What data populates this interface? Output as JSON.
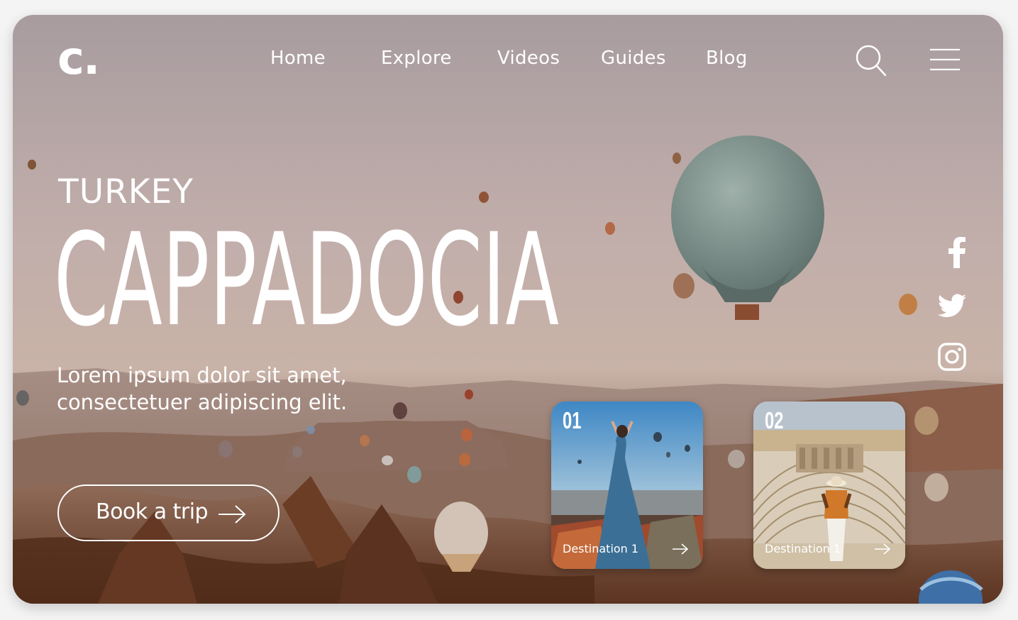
{
  "brand": {
    "logo": "c."
  },
  "nav": {
    "items": [
      "Home",
      "Explore",
      "Videos",
      "Guides",
      "Blog"
    ],
    "search_icon": "search-icon",
    "menu_icon": "hamburger-menu-icon"
  },
  "hero": {
    "eyebrow": "TURKEY",
    "title": "CAPPADOCIA",
    "lead_line1": "Lorem ipsum dolor sit amet,",
    "lead_line2": "consectetuer adipiscing elit.",
    "cta_label": "Book a trip",
    "cta_icon": "arrow-right-icon"
  },
  "social": [
    "facebook-icon",
    "twitter-icon",
    "instagram-icon"
  ],
  "destinations": [
    {
      "number": "01",
      "label": "Destination 1"
    },
    {
      "number": "02",
      "label": "Destination 1"
    }
  ],
  "colors": {
    "text": "#ffffff",
    "sky": "#b9a6a4",
    "ground": "#7a4a2e"
  }
}
